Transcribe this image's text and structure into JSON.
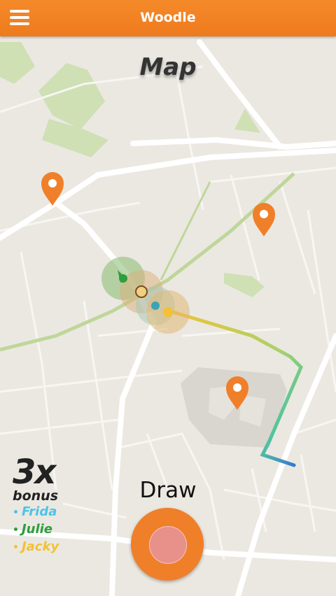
{
  "app": {
    "title": "Woodle"
  },
  "page": {
    "title": "Map"
  },
  "bonus": {
    "multiplier": "3x",
    "label": "bonus",
    "players": [
      {
        "name": "Frida",
        "color": "#4fc3e8"
      },
      {
        "name": "Julie",
        "color": "#2e9e3e"
      },
      {
        "name": "Jacky",
        "color": "#f2c233"
      }
    ]
  },
  "draw": {
    "label": "Draw"
  },
  "colors": {
    "accent": "#f07f2a",
    "map_bg": "#ebe8e1",
    "park": "#cfe0b4"
  },
  "icons": [
    "hamburger-menu-icon",
    "map-pin-icon",
    "record-button-icon"
  ]
}
